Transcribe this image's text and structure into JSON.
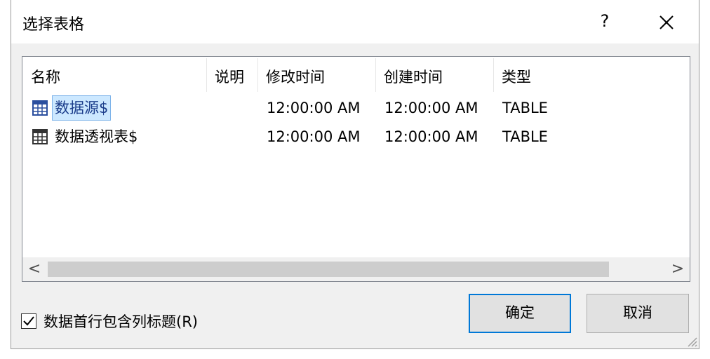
{
  "dialog": {
    "title": "选择表格",
    "help_label": "?",
    "close_icon": "close-icon"
  },
  "table": {
    "columns": [
      "名称",
      "说明",
      "修改时间",
      "创建时间",
      "类型"
    ],
    "rows": [
      {
        "name": "数据源$",
        "description": "",
        "modified": "12:00:00 AM",
        "created": "12:00:00 AM",
        "type": "TABLE",
        "selected": true
      },
      {
        "name": "数据透视表$",
        "description": "",
        "modified": "12:00:00 AM",
        "created": "12:00:00 AM",
        "type": "TABLE",
        "selected": false
      }
    ],
    "row_icon": "table-grid-icon"
  },
  "scrollbar": {
    "left_arrow": "<",
    "right_arrow": ">"
  },
  "option": {
    "label": "数据首行包含列标题(R)",
    "checked": true
  },
  "buttons": {
    "ok_label": "确定",
    "cancel_label": "取消"
  },
  "colors": {
    "accent": "#0078d7",
    "selection": "#cce8ff"
  }
}
